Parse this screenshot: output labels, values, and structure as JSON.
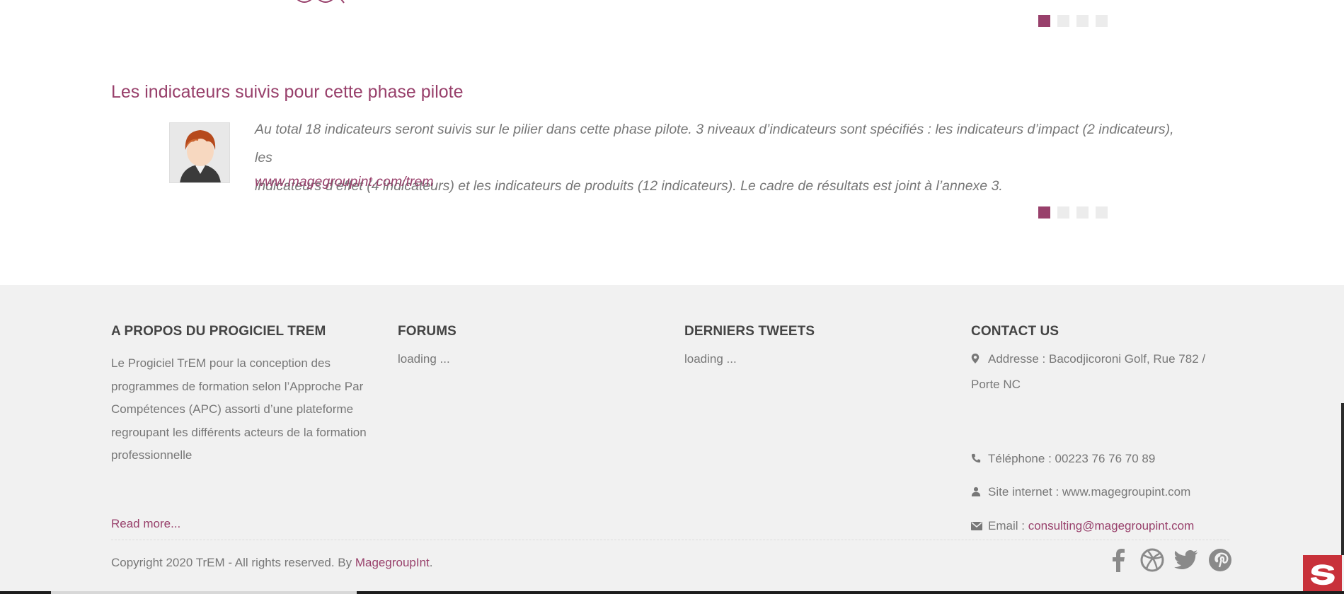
{
  "testimonial": {
    "title": "Les indicateurs suivis pour cette phase pilote",
    "quote_line1": "Au total 18 indicateurs seront suivis sur le pilier dans cette phase pilote. 3 niveaux d’indicateurs sont spécifiés : les indicateurs d’impact (2 indicateurs), les",
    "quote_line2": "indicateurs d’effet (4 indicateurs) et les indicateurs de produits (12 indicateurs). Le cadre de résultats est joint à l’annexe 3.",
    "link": "www.magegroupint.com/trem"
  },
  "pagers": [
    {
      "active_index": 0,
      "count": 4
    },
    {
      "active_index": 0,
      "count": 4
    }
  ],
  "footer": {
    "about": {
      "heading": "A PROPOS DU PROGICIEL TREM",
      "description": "Le Progiciel TrEM pour la conception des programmes de formation selon l’Approche Par Compétences (APC) assorti d’une plateforme regroupant les différents acteurs de la formation professionnelle",
      "read_more": "Read more..."
    },
    "forums": {
      "heading": "FORUMS",
      "status": "loading ..."
    },
    "tweets": {
      "heading": "DERNIERS TWEETS",
      "status": "loading ..."
    },
    "contact": {
      "heading": "CONTACT US",
      "address": "Addresse : Bacodjicoroni Golf, Rue 782 / Porte NC",
      "phone": "Téléphone : 00223 76 76 70 89",
      "website": "Site internet : www.magegroupint.com",
      "email_label": "Email : ",
      "email": "consulting@magegroupint.com"
    },
    "copyright_prefix": "Copyright 2020 TrEM - All rights reserved. By ",
    "copyright_link": "MagegroupInt",
    "copyright_suffix": ".",
    "social": [
      "facebook-icon",
      "dribbble-icon",
      "twitter-icon",
      "pinterest-icon"
    ]
  },
  "colors": {
    "accent": "#98406b",
    "footer_bg": "#f1f1f1",
    "text": "#777777",
    "badge": "#c8313a"
  }
}
